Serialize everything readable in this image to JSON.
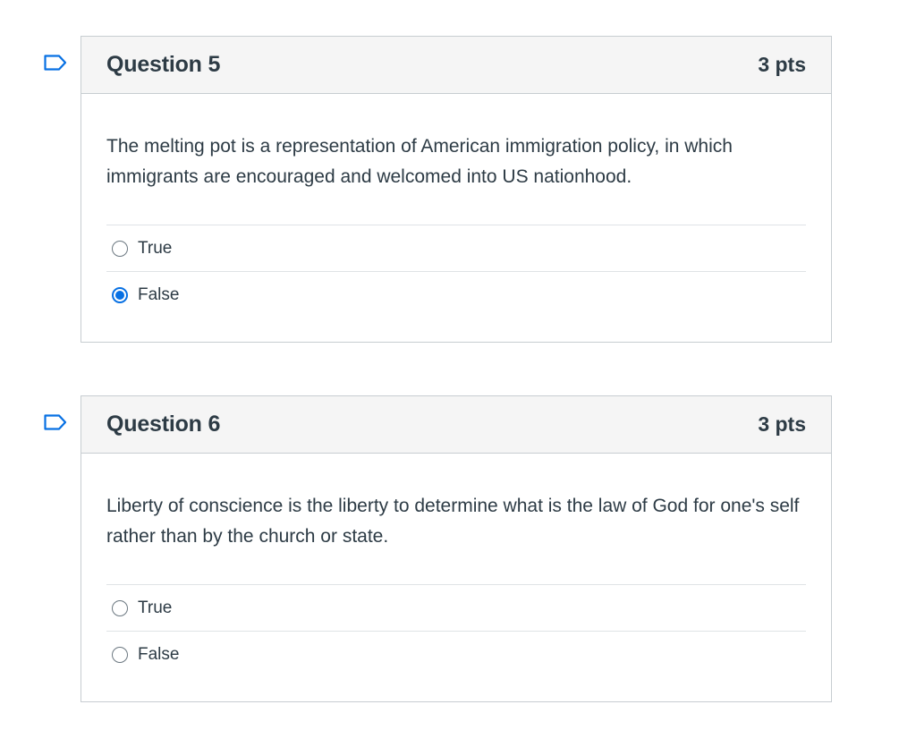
{
  "questions": [
    {
      "title": "Question 5",
      "points": "3 pts",
      "text": "The melting pot is a representation of American immigration policy, in which immigrants are encouraged and welcomed into US nationhood.",
      "options": [
        {
          "label": "True",
          "selected": false
        },
        {
          "label": "False",
          "selected": true
        }
      ],
      "flag_icon": "flag-icon"
    },
    {
      "title": "Question 6",
      "points": "3 pts",
      "text": "Liberty of conscience is the liberty to determine what is the law of God for one's self rather than by the church or state.",
      "options": [
        {
          "label": "True",
          "selected": false
        },
        {
          "label": "False",
          "selected": false
        }
      ],
      "flag_icon": "flag-icon"
    }
  ],
  "colors": {
    "accent": "#0770e3",
    "border": "#c7cdd1",
    "header_bg": "#f5f5f5",
    "text": "#2d3b45",
    "flag": "#0770e3"
  }
}
